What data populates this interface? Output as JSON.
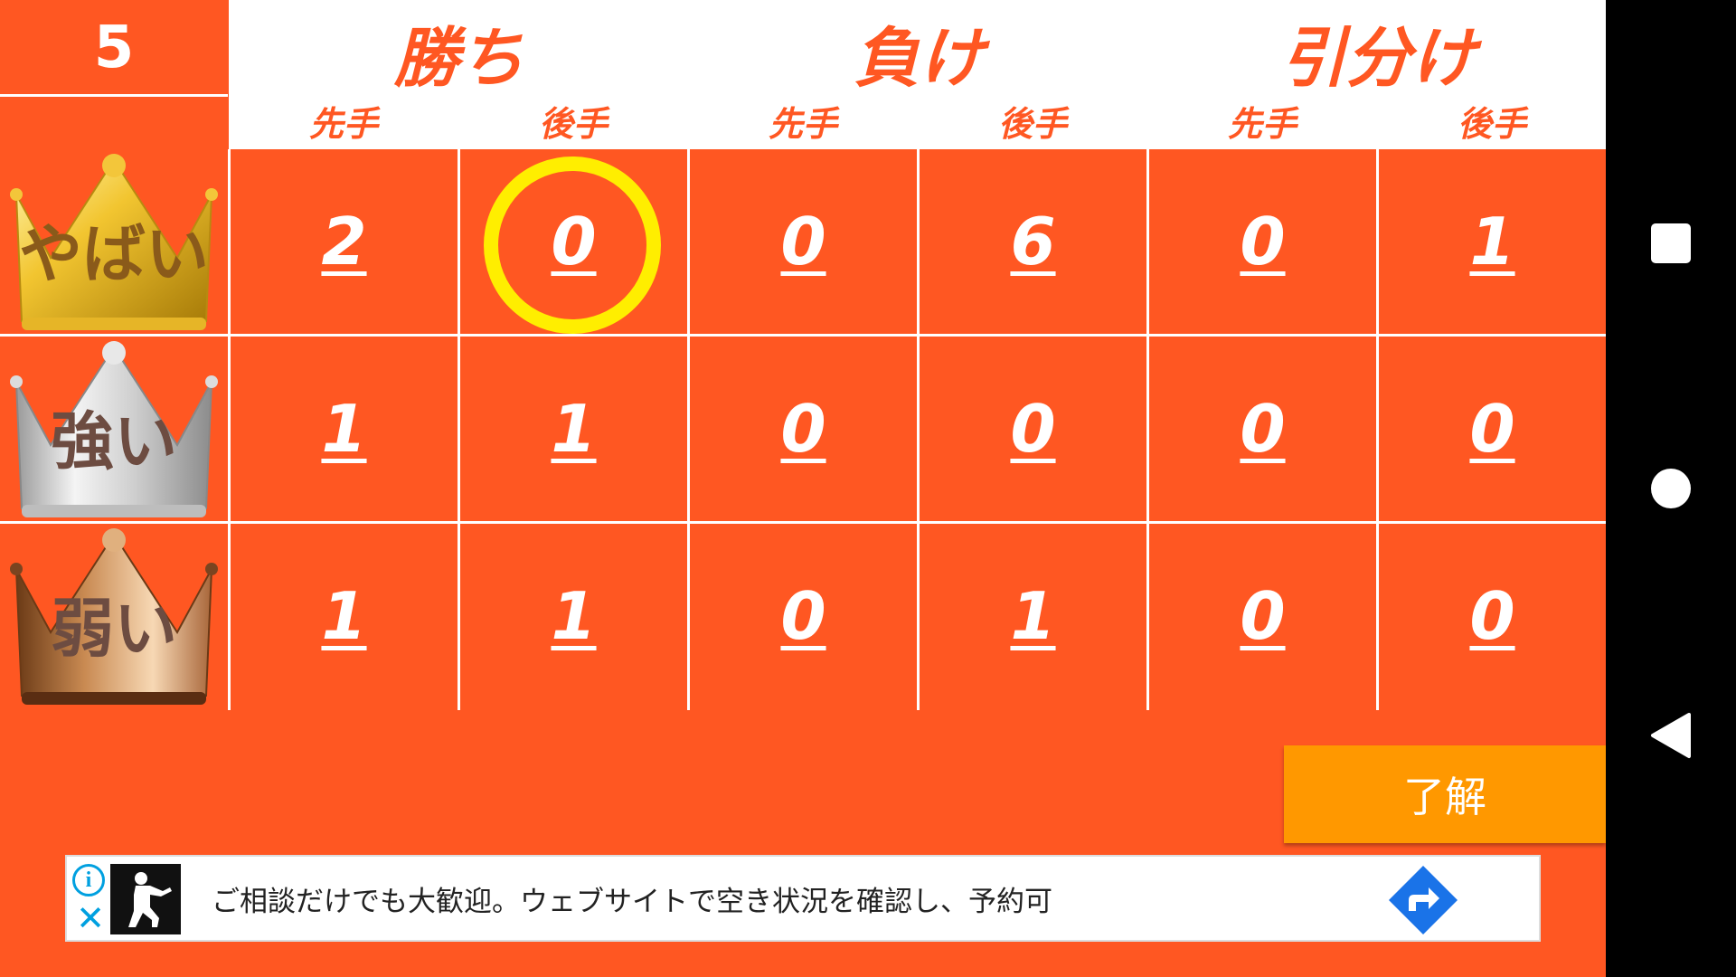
{
  "level": "5",
  "groups": [
    {
      "label": "勝ち",
      "sub": [
        "先手",
        "後手"
      ]
    },
    {
      "label": "負け",
      "sub": [
        "先手",
        "後手"
      ]
    },
    {
      "label": "引分け",
      "sub": [
        "先手",
        "後手"
      ]
    }
  ],
  "rows": [
    {
      "name": "やばい",
      "crown": "gold",
      "values": [
        "2",
        "0",
        "0",
        "6",
        "0",
        "1"
      ]
    },
    {
      "name": "強い",
      "crown": "silver",
      "values": [
        "1",
        "1",
        "0",
        "0",
        "0",
        "0"
      ]
    },
    {
      "name": "弱い",
      "crown": "bronze",
      "values": [
        "1",
        "1",
        "0",
        "1",
        "0",
        "0"
      ]
    }
  ],
  "highlight": {
    "row": 0,
    "col": 1,
    "color": "#ffee00"
  },
  "ok_button": "了解",
  "ad": {
    "text": "ご相談だけでも大歓迎。ウェブサイトで空き状況を確認し、予約可",
    "info_icon": "i",
    "close_icon": "✕"
  },
  "colors": {
    "background": "#ff5722",
    "button": "#ff9800",
    "header": "#ffffff"
  }
}
